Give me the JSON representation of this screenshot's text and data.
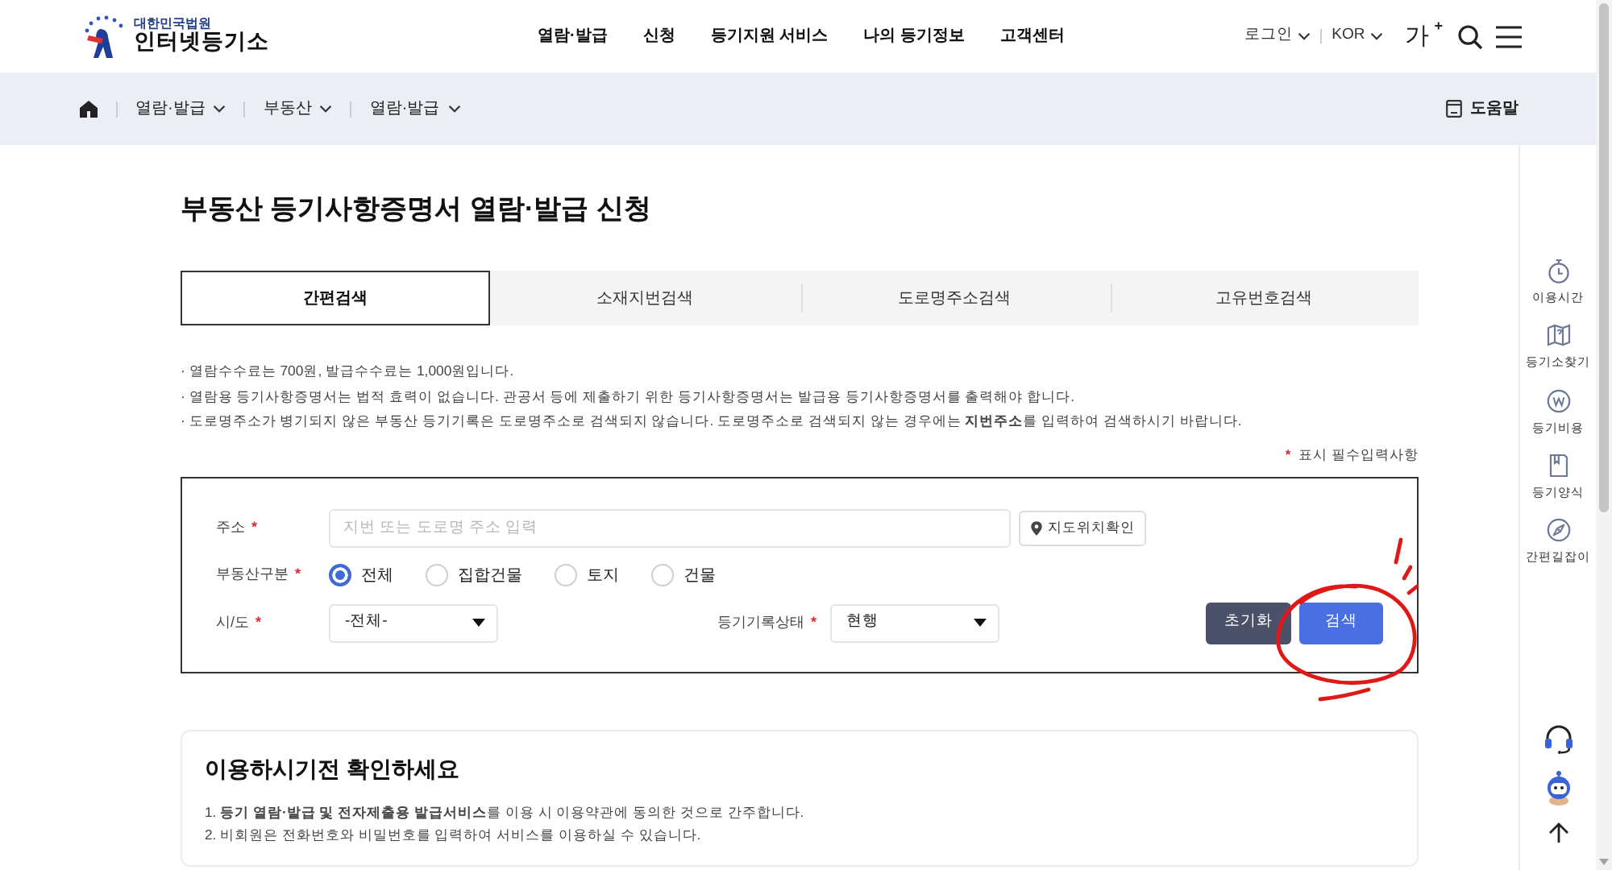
{
  "header": {
    "logo": {
      "subtitle": "대한민국법원",
      "title": "인터넷등기소"
    },
    "nav": [
      {
        "label": "열람·발급"
      },
      {
        "label": "신청"
      },
      {
        "label": "등기지원 서비스"
      },
      {
        "label": "나의 등기정보"
      },
      {
        "label": "고객센터"
      }
    ],
    "login": "로그인",
    "language": "KOR",
    "font_size": "가$^{+}$"
  },
  "breadcrumb": {
    "items": [
      {
        "label": "열람·발급"
      },
      {
        "label": "부동산"
      },
      {
        "label": "열람·발급"
      }
    ],
    "help": "도움말"
  },
  "page_title": "부동산 등기사항증명서 열람·발급 신청",
  "tabs": [
    {
      "label": "간편검색",
      "selected": true
    },
    {
      "label": "소재지번검색",
      "selected": false
    },
    {
      "label": "도로명주소검색",
      "selected": false
    },
    {
      "label": "고유번호검색",
      "selected": false
    }
  ],
  "notes": [
    "· 열람수수료는  700원, 발급수수료는  1,000원입니다.",
    "· 열람용 등기사항증명서는 법적 효력이 없습니다. 관공서 등에 제출하기 위한 등기사항증명서는 발급용 등기사항증명서를 출력해야 합니다.",
    "· 도로명주소가 병기되지 않은 부동산 등기기록은 도로명주소로 검색되지 않습니다. 도로명주소로 검색되지 않는 경우에는 **지번주소**를 입력하여 검색하시기 바랍니다."
  ],
  "form": {
    "required_mark": "*",
    "required_note": "표시 필수입력사항",
    "address": {
      "label": "주소",
      "required": true,
      "placeholder": "지번 또는 도로명 주소 입력",
      "map_button": "지도위치확인"
    },
    "property_type": {
      "label": "부동산구분",
      "required": true,
      "options": [
        {
          "label": "전체",
          "selected": true
        },
        {
          "label": "집합건물",
          "selected": false
        },
        {
          "label": "토지",
          "selected": false
        },
        {
          "label": "건물",
          "selected": false
        }
      ]
    },
    "region": {
      "label": "시/도",
      "required": true,
      "value": "-전체-"
    },
    "record_status": {
      "label": "등기기록상태",
      "required": true,
      "value": "현행"
    },
    "buttons": [
      {
        "label": "초기화",
        "kind": "reset",
        "circled": false
      },
      {
        "label": "검색",
        "kind": "search",
        "circled": true
      }
    ]
  },
  "guide": {
    "title": "이용하시기전 확인하세요",
    "items": [
      "1. **등기 열람·발급 및 전자제출용 발급서비스**를 이용 시 이용약관에 동의한 것으로 간주합니다.",
      "2. 비회원은 전화번호와 비밀번호를 입력하여 서비스를 이용하실 수 있습니다."
    ]
  },
  "side_menu": [
    {
      "label": "이용시간",
      "kind": "hours"
    },
    {
      "label": "등기소찾기",
      "kind": "finder"
    },
    {
      "label": "등기비용",
      "kind": "fee"
    },
    {
      "label": "등기양식",
      "kind": "form"
    },
    {
      "label": "간편길잡이",
      "kind": "guide"
    }
  ],
  "quick_buttons": [
    {
      "kind": "headset"
    },
    {
      "kind": "chatbot"
    },
    {
      "kind": "top"
    }
  ]
}
